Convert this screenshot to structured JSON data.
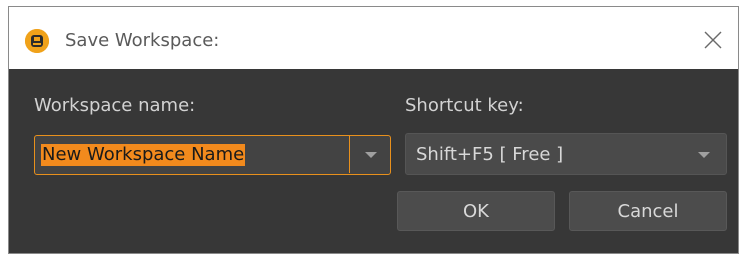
{
  "dialog": {
    "title": "Save Workspace:",
    "app_icon": "app-logo-icon",
    "close_icon": "close-icon"
  },
  "workspace_name": {
    "label": "Workspace name:",
    "value": "New Workspace Name"
  },
  "shortcut_key": {
    "label": "Shortcut key:",
    "value": "Shift+F5 [ Free ]"
  },
  "buttons": {
    "ok_label": "OK",
    "cancel_label": "Cancel"
  },
  "colors": {
    "accent": "#f28a1d",
    "dialog_bg": "#373737"
  }
}
